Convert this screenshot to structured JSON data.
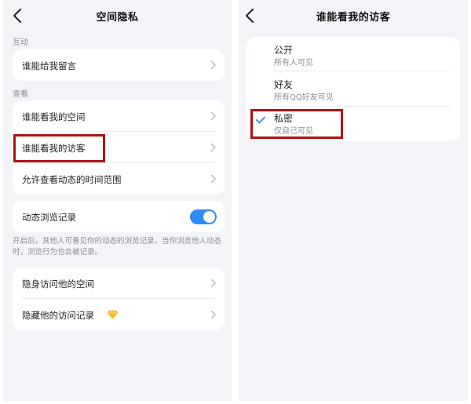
{
  "left": {
    "title": "空间隐私",
    "section_interact": "互动",
    "who_can_comment": "谁能给我留言",
    "section_view": "查看",
    "who_can_view_space": "谁能看我的空间",
    "who_can_view_visitors": "谁能看我的访客",
    "time_range": "允许查看动态的时间范围",
    "browse_record": "动态浏览记录",
    "browse_record_enabled": true,
    "note": "开启后，其他人可看见你的动态的浏览记录。当你浏览他人动态时，浏览行为也会被记录。",
    "invisible_visit": "隐身访问他的空间",
    "hide_visit_record": "隐藏他的访问记录"
  },
  "right": {
    "title": "谁能看我的访客",
    "options": [
      {
        "title": "公开",
        "subtitle": "所有人可见",
        "selected": false
      },
      {
        "title": "好友",
        "subtitle": "所有QQ好友可见",
        "selected": false
      },
      {
        "title": "私密",
        "subtitle": "仅自己可见",
        "selected": true
      }
    ]
  },
  "colors": {
    "accent": "#2f8cf6",
    "highlight_box": "#b01212",
    "background": "#f3f4f8",
    "gem": "#f5b92e"
  },
  "icons": [
    "back-icon",
    "chevron-right-icon",
    "toggle-switch",
    "diamond-icon",
    "checkmark-icon"
  ]
}
